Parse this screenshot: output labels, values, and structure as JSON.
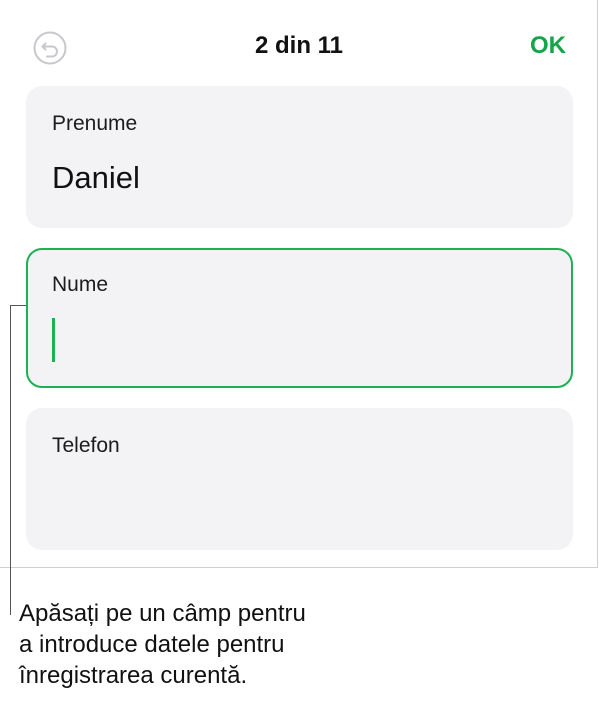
{
  "header": {
    "title": "2 din 11",
    "ok_label": "OK",
    "undo_icon": "undo-icon"
  },
  "fields": [
    {
      "label": "Prenume",
      "value": "Daniel",
      "focused": false
    },
    {
      "label": "Nume",
      "value": "",
      "focused": true
    },
    {
      "label": "Telefon",
      "value": "",
      "focused": false
    }
  ],
  "caption": {
    "line1": "Apăsați pe un câmp pentru",
    "line2": "a introduce datele pentru",
    "line3": "înregistrarea curentă."
  },
  "colors": {
    "accent": "#1eb054",
    "field_background": "#f3f3f5"
  }
}
